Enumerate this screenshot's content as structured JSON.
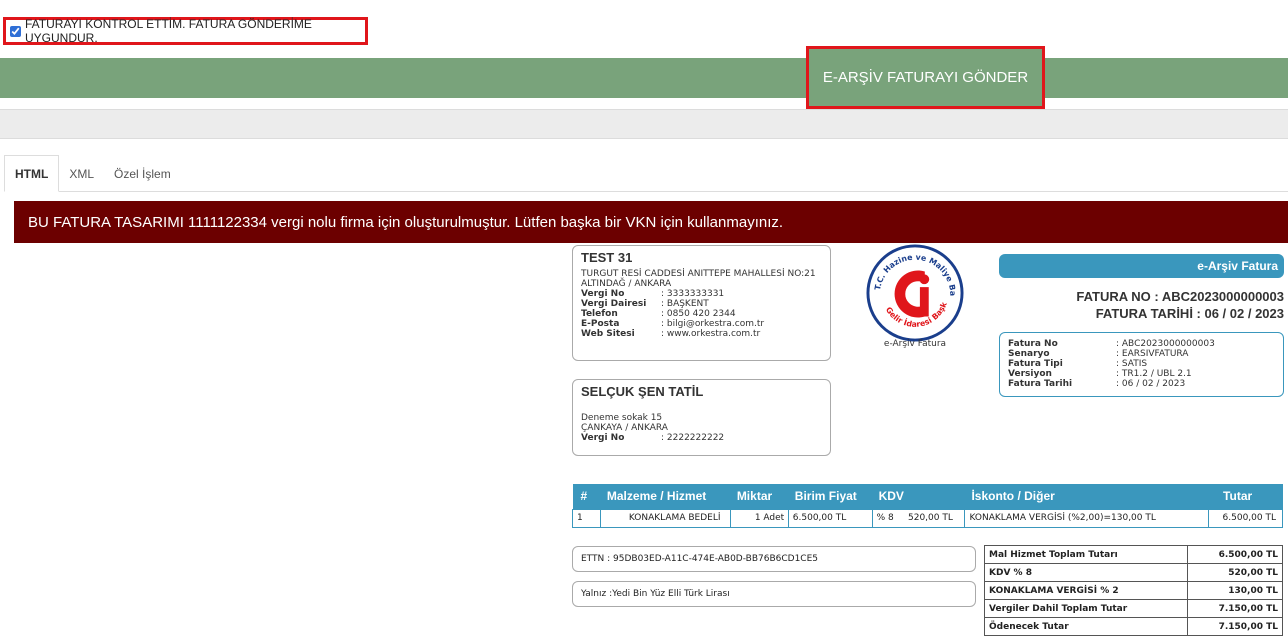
{
  "confirm": {
    "label": "FATURAYI KONTROL ETTİM. FATURA GÖNDERİME UYGUNDUR.",
    "checked": true
  },
  "send_button": "E-ARŞİV FATURAYI GÖNDER",
  "tabs": [
    "HTML",
    "XML",
    "Özel İşlem"
  ],
  "warning": "BU FATURA TASARIMI 1111122334 vergi nolu firma için oluşturulmuştur. Lütfen başka bir VKN için kullanmayınız.",
  "seller": {
    "name": "TEST 31",
    "address": "TURGUT RESİ CADDESİ ANITTEPE MAHALLESİ NO:21",
    "city": "ALTINDAĞ   /   ANKARA",
    "fields": [
      {
        "k": "Vergi No",
        "v": ": 3333333331"
      },
      {
        "k": "Vergi Dairesi",
        "v": ": BAŞKENT"
      },
      {
        "k": "Telefon",
        "v": ": 0850 420 2344"
      },
      {
        "k": "E-Posta",
        "v": ": bilgi@orkestra.com.tr"
      },
      {
        "k": "Web Sitesi",
        "v": ": www.orkestra.com.tr"
      }
    ]
  },
  "buyer": {
    "name": "SELÇUK ŞEN TATİL",
    "address": "Deneme sokak 15",
    "city": "ÇANKAYA   /   ANKARA",
    "fields": [
      {
        "k": "Vergi No",
        "v": ": 2222222222"
      }
    ]
  },
  "logo": {
    "caption": "e-Arşiv Fatura",
    "ring_text": "T.C. Hazine ve Maliye Bakanlığı · Gelir İdaresi Başkanlığı"
  },
  "badge": "e-Arşiv Fatura",
  "invoice_no_line": "FATURA NO : ABC2023000000003",
  "invoice_date_line": "FATURA TARİHİ : 06 / 02 / 2023",
  "meta": [
    {
      "k": "Fatura No",
      "v": ": ABC2023000000003"
    },
    {
      "k": "Senaryo",
      "v": ": EARSIVFATURA"
    },
    {
      "k": "Fatura Tipi",
      "v": ": SATIS"
    },
    {
      "k": "Versiyon",
      "v": ": TR1.2 / UBL 2.1"
    },
    {
      "k": "Fatura Tarihi",
      "v": ": 06 / 02 / 2023"
    }
  ],
  "items_header": [
    "#",
    "Malzeme / Hizmet",
    "Miktar",
    "Birim Fiyat",
    "KDV",
    "İskonto / Diğer",
    "Tutar"
  ],
  "items": [
    [
      "1",
      "KONAKLAMA BEDELİ",
      "1 Adet",
      "6.500,00 TL",
      "% 8     520,00 TL",
      "KONAKLAMA VERGİSİ (%2,00)=130,00 TL",
      "6.500,00 TL"
    ]
  ],
  "ettn": "ETTN : 95DB03ED-A11C-474E-AB0D-BB76B6CD1CE5",
  "yalniz": "Yalnız :Yedi Bin Yüz Elli Türk Lirası",
  "totals": [
    {
      "label": "Mal Hizmet Toplam Tutarı",
      "value": "6.500,00 TL"
    },
    {
      "label": "KDV % 8",
      "value": "520,00 TL"
    },
    {
      "label": "KONAKLAMA VERGİSİ % 2",
      "value": "130,00 TL"
    },
    {
      "label": "Vergiler Dahil Toplam Tutar",
      "value": "7.150,00 TL"
    },
    {
      "label": "Ödenecek Tutar",
      "value": "7.150,00 TL"
    }
  ],
  "colors": {
    "green": "#79a37b",
    "red_outline": "#e0161b",
    "warning_bg": "#6c0000",
    "blue": "#3a97bd"
  }
}
